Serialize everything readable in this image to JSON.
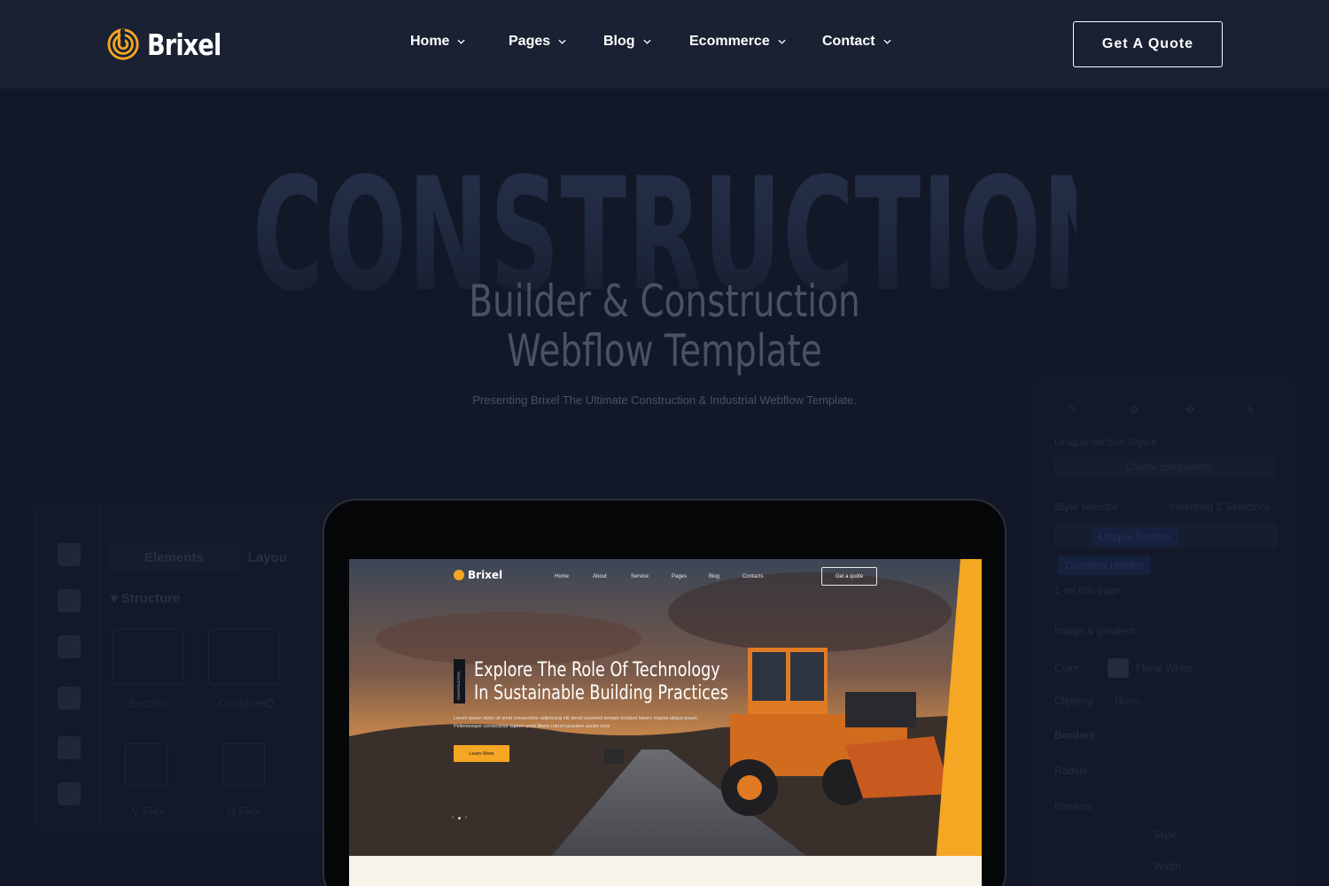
{
  "brand": {
    "name": "Brixel",
    "accent": "#f5a623",
    "background": "#121828",
    "nav_background": "#1a2133"
  },
  "nav": {
    "items": [
      {
        "label": "Home"
      },
      {
        "label": "Pages"
      },
      {
        "label": "Blog"
      },
      {
        "label": "Ecommerce"
      },
      {
        "label": "Contact"
      }
    ],
    "cta": "Get A Quote",
    "icons": [
      "brixel-logo-icon",
      "chevron-down-icon"
    ]
  },
  "hero": {
    "bigword": "CONSTRUCTION",
    "title_line1": "Builder & Construction",
    "title_line2": "Webflow Template",
    "subtitle": "Presenting Brixel The Ultimate Construction & Industrial Webflow Template."
  },
  "left_panel": {
    "tabs": [
      "Elements",
      "Layou"
    ],
    "section_title": "Structure",
    "tiles": [
      "Section",
      "Container",
      "V Flex",
      "H Flex"
    ],
    "partial_label": "Q"
  },
  "right_panel": {
    "rows": [
      "Unique section Styles",
      "Create component",
      "Style selector",
      "Inheriting 2 Selectors",
      "Unique Section",
      "Overflow Hidden",
      "1 on this page",
      "Image & gradient",
      "Color",
      "Floral White",
      "Clipping",
      "None",
      "Borders",
      "Radius",
      "Borders",
      "Style",
      "Width"
    ]
  },
  "device_screen": {
    "logo": "Brixel",
    "links": [
      "Home",
      "About",
      "Service",
      "Pages",
      "Blog",
      "Contacts"
    ],
    "cta": "Get a quote",
    "badge": "CONSTRUCTION",
    "heading_line1": "Explore The Role Of Technology",
    "heading_line2": "In Sustainable Building Practices",
    "body": "Lorem ipsum dolor sit amet consectetur adipiscing elit dendi eiusmod tempor incidunt labore magna aliqua ipsum. Pellentesque consectetur sapien amet libero rutrum posuere auctor eros",
    "button": "Learn More"
  }
}
